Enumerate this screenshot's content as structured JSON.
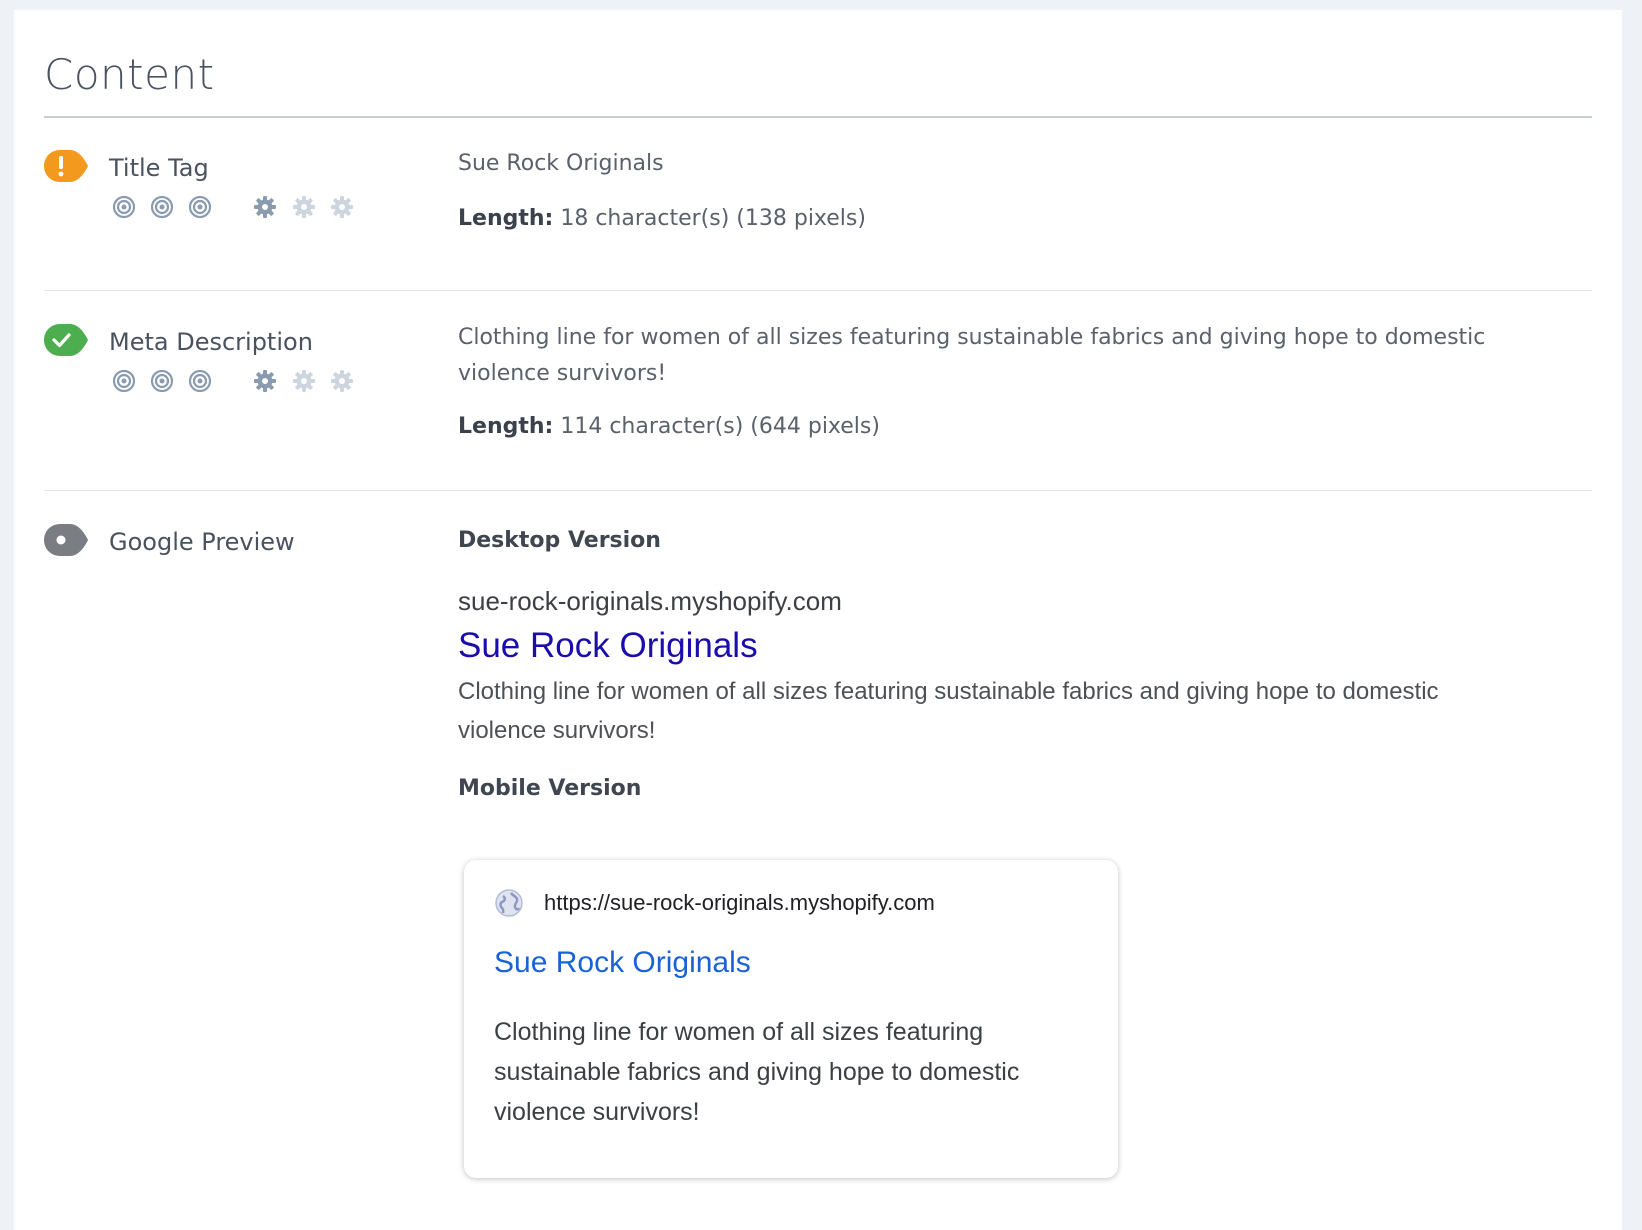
{
  "page": {
    "title": "Content"
  },
  "title_tag": {
    "label": "Title Tag",
    "status": "warning",
    "status_color": "#f39a1e",
    "importance_icons": [
      "target-icon",
      "target-icon",
      "target-icon"
    ],
    "difficulty_icons": [
      "gear-icon",
      "gear-icon-faded",
      "gear-icon-faded"
    ],
    "value": "Sue Rock Originals",
    "length_label": "Length:",
    "length_value": "18 character(s) (138 pixels)"
  },
  "meta_description": {
    "label": "Meta Description",
    "status": "pass",
    "status_color": "#4cae4f",
    "importance_icons": [
      "target-icon",
      "target-icon",
      "target-icon"
    ],
    "difficulty_icons": [
      "gear-icon",
      "gear-icon-faded",
      "gear-icon-faded"
    ],
    "value": "Clothing line for women of all sizes featuring sustainable fabrics and giving hope to domestic violence survivors!",
    "length_label": "Length:",
    "length_value": "114 character(s) (644 pixels)"
  },
  "google_preview": {
    "label": "Google Preview",
    "status": "info",
    "status_color": "#7a7d82",
    "desktop": {
      "heading": "Desktop Version",
      "url": "sue-rock-originals.myshopify.com",
      "title": "Sue Rock Originals",
      "description": "Clothing line for women of all sizes featuring sustainable fabrics and giving hope to domestic violence survivors!"
    },
    "mobile": {
      "heading": "Mobile Version",
      "url": "https://sue-rock-originals.myshopify.com",
      "title": "Sue Rock Originals",
      "description": "Clothing line for women of all sizes featuring sustainable fabrics and giving hope to domestic violence survivors!"
    }
  }
}
